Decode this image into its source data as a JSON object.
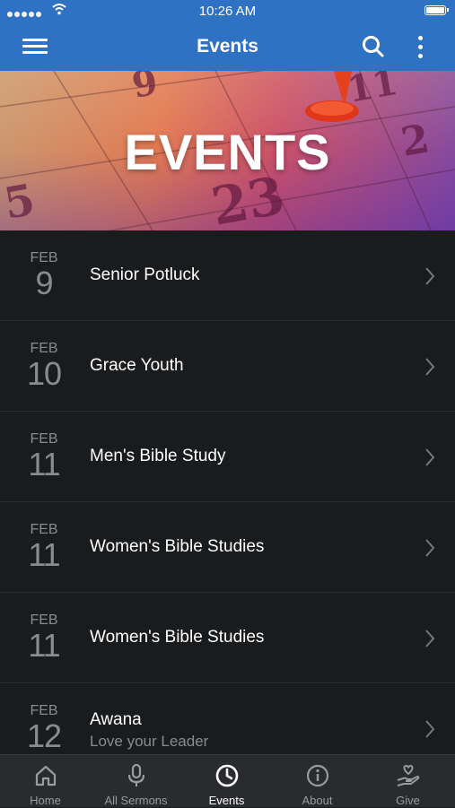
{
  "status_bar": {
    "time": "10:26 AM"
  },
  "nav": {
    "title": "Events"
  },
  "banner": {
    "title": "EVENTS"
  },
  "events": [
    {
      "month": "FEB",
      "day": "9",
      "name": "Senior Potluck",
      "subtitle": ""
    },
    {
      "month": "FEB",
      "day": "10",
      "name": "Grace Youth",
      "subtitle": ""
    },
    {
      "month": "FEB",
      "day": "11",
      "name": "Men's Bible Study",
      "subtitle": ""
    },
    {
      "month": "FEB",
      "day": "11",
      "name": "Women's Bible Studies",
      "subtitle": ""
    },
    {
      "month": "FEB",
      "day": "11",
      "name": "Women's Bible Studies",
      "subtitle": ""
    },
    {
      "month": "FEB",
      "day": "12",
      "name": "Awana",
      "subtitle": "Love your Leader"
    }
  ],
  "tabs": [
    {
      "label": "Home",
      "icon": "home-icon",
      "active": false
    },
    {
      "label": "All Sermons",
      "icon": "microphone-icon",
      "active": false
    },
    {
      "label": "Events",
      "icon": "clock-icon",
      "active": true
    },
    {
      "label": "About",
      "icon": "info-icon",
      "active": false
    },
    {
      "label": "Give",
      "icon": "give-hand-heart-icon",
      "active": false
    }
  ],
  "colors": {
    "header": "#2f72c4",
    "list_background": "#1a1b1d",
    "tab_bar": "#2a2b2e",
    "muted_text": "#8a8b8e"
  }
}
